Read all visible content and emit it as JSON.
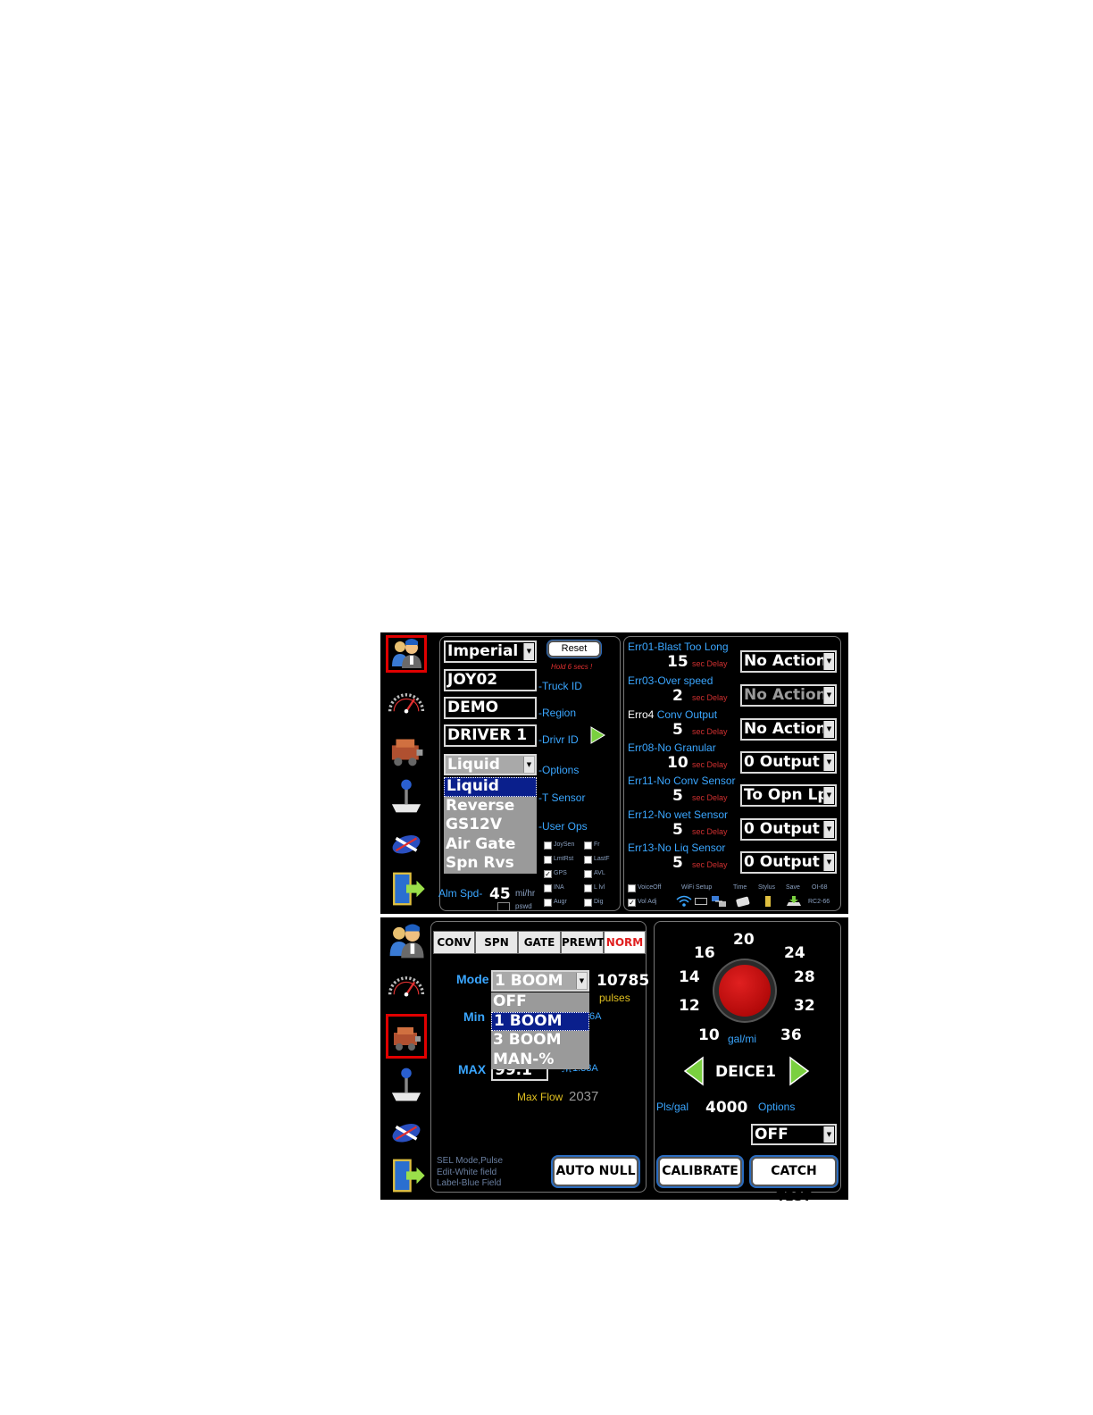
{
  "screen1": {
    "left": {
      "units": "Imperial",
      "reset_label": "Reset",
      "reset_hint": "Hold 6 secs !",
      "truck_id": {
        "value": "JOY02",
        "label": "-Truck ID"
      },
      "region": {
        "value": "DEMO",
        "label": "-Region"
      },
      "driver_id": {
        "value": "DRIVER 1",
        "label": "-Drivr ID"
      },
      "options": {
        "value": "Liquid",
        "label": "-Options"
      },
      "t_sensor_label": "-T Sensor",
      "user_ops_label": "-User Ops",
      "options_dropdown": [
        "Liquid",
        "Reverse",
        "GS12V",
        "Air Gate",
        "Spn Rvs"
      ],
      "options_selected_index": 0,
      "checkboxes": [
        {
          "label": "JoySen",
          "checked": false
        },
        {
          "label": "Fr",
          "checked": false
        },
        {
          "label": "LmtRst",
          "checked": false
        },
        {
          "label": "LastF",
          "checked": false
        },
        {
          "label": "GPS",
          "checked": true
        },
        {
          "label": "AVL",
          "checked": false
        },
        {
          "label": "INA",
          "checked": false
        },
        {
          "label": "L lvl",
          "checked": false
        },
        {
          "label": "Augr",
          "checked": false
        },
        {
          "label": "Dig",
          "checked": false
        }
      ],
      "alarm_speed": {
        "label": "Alm Spd-",
        "value": "45",
        "unit": "mi/hr",
        "pswd": "pswd"
      }
    },
    "errors": [
      {
        "label": "Err01-Blast Too Long",
        "delay": "15",
        "delay_label": "sec Delay",
        "action": "No Action",
        "dim": false
      },
      {
        "label": "Err03-Over speed",
        "delay": "2",
        "delay_label": "sec Delay",
        "action": "No Action",
        "dim": true
      },
      {
        "label_prefix": "Erro4 ",
        "label": "Conv Output",
        "delay": "5",
        "delay_label": "sec Delay",
        "action": "No Action",
        "dim": false
      },
      {
        "label": "Err08-No Granular",
        "delay": "10",
        "delay_label": "sec Delay",
        "action": "0 Output",
        "dim": false
      },
      {
        "label": "Err11-No Conv Sensor",
        "delay": "5",
        "delay_label": "sec Delay",
        "action": "To Opn Lp",
        "dim": false
      },
      {
        "label": "Err12-No wet Sensor",
        "delay": "5",
        "delay_label": "sec Delay",
        "action": "0 Output",
        "dim": false
      },
      {
        "label": "Err13-No Liq Sensor",
        "delay": "5",
        "delay_label": "sec Delay",
        "action": "0 Output",
        "dim": false
      }
    ],
    "bottom": {
      "voice_off": {
        "label": "VoiceOff",
        "checked": false
      },
      "vol_adj": {
        "label": "Vol Adj",
        "checked": true
      },
      "wifi_setup": "WiFi Setup",
      "time": "Time",
      "stylus": "Stylus",
      "save": "Save",
      "oi": "OI-68",
      "rc": "RC2-66"
    }
  },
  "screen2": {
    "tabs": [
      "CONV",
      "SPN",
      "GATE",
      "PREWT",
      "NORM"
    ],
    "active_tab": 4,
    "mode_label": "Mode",
    "mode_value": "1 BOOM",
    "mode_dropdown": [
      "OFF",
      "1 BOOM",
      "3 BOOM",
      "MAN-%"
    ],
    "mode_selected_index": 1,
    "pulses_value": "10785",
    "pulses_label": "pulses",
    "min_label": "Min",
    "min_suffix": "6A",
    "max_label": "MAX",
    "max_value": "99.1",
    "max_suffix": "1.38A",
    "max_suffix_prefix": "ℳ",
    "max_flow_label": "Max Flow",
    "max_flow_value": "2037",
    "hints": [
      "SEL Mode,Pulse",
      "Edit-White field",
      "Label-Blue Field"
    ],
    "auto_null": "AUTO NULL",
    "dial": {
      "numbers": [
        "20",
        "16",
        "24",
        "14",
        "28",
        "12",
        "32",
        "10",
        "36"
      ],
      "unit": "gal/mi"
    },
    "profile": "DEICE1",
    "pls_gal_label": "Pls/gal",
    "pls_gal_value": "4000",
    "options_label": "Options",
    "options_value": "OFF",
    "calibrate": "CALIBRATE",
    "catch_test": "CATCH TEST"
  },
  "sidebar": [
    "user-icon",
    "speedometer-icon",
    "spreader-icon",
    "joystick-icon",
    "flag-icon",
    "exit-icon"
  ]
}
